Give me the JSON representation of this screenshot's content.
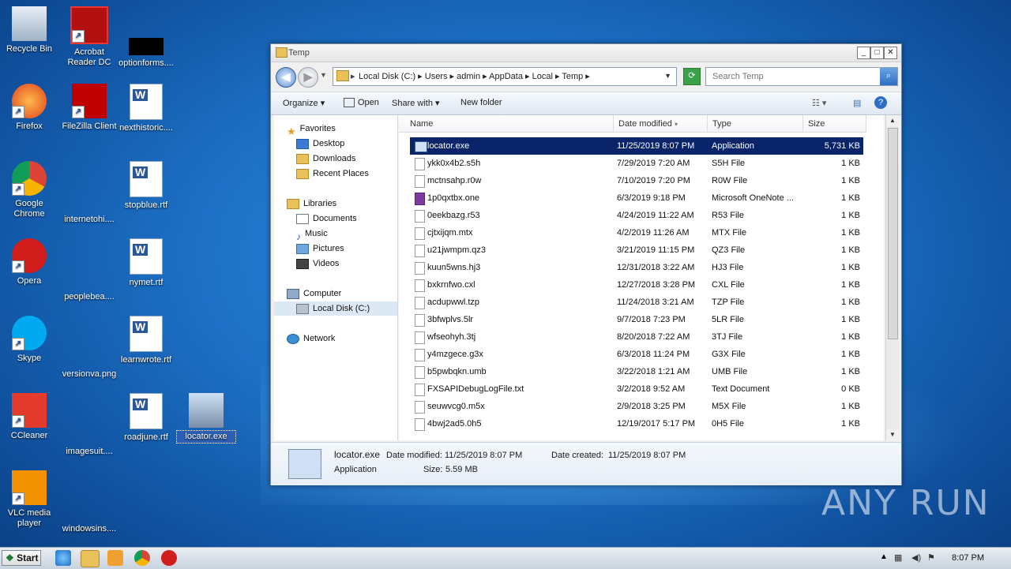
{
  "desktop": {
    "icons": [
      {
        "label": "Recycle Bin",
        "icon": "recycle-bin-icon"
      },
      {
        "label": "Acrobat Reader DC",
        "icon": "acrobat-icon"
      },
      {
        "label": "optionforms....",
        "icon": "file-icon"
      },
      {
        "label": "Firefox",
        "icon": "firefox-icon"
      },
      {
        "label": "FileZilla Client",
        "icon": "filezilla-icon"
      },
      {
        "label": "nexthistoric....",
        "icon": "word-document-icon"
      },
      {
        "label": "Google Chrome",
        "icon": "chrome-icon"
      },
      {
        "label": "internetohi....",
        "icon": "file-icon"
      },
      {
        "label": "stopblue.rtf",
        "icon": "word-document-icon"
      },
      {
        "label": "Opera",
        "icon": "opera-icon"
      },
      {
        "label": "peoplebea....",
        "icon": "file-icon"
      },
      {
        "label": "nymet.rtf",
        "icon": "word-document-icon"
      },
      {
        "label": "Skype",
        "icon": "skype-icon"
      },
      {
        "label": "versionva.png",
        "icon": "file-icon"
      },
      {
        "label": "learnwrote.rtf",
        "icon": "word-document-icon"
      },
      {
        "label": "CCleaner",
        "icon": "ccleaner-icon"
      },
      {
        "label": "imagesuit....",
        "icon": "file-icon"
      },
      {
        "label": "roadjune.rtf",
        "icon": "word-document-icon"
      },
      {
        "label": "locator.exe",
        "icon": "application-icon"
      },
      {
        "label": "VLC media player",
        "icon": "vlc-icon"
      },
      {
        "label": "windowsins....",
        "icon": "file-icon"
      }
    ]
  },
  "window": {
    "title": "Temp",
    "address": {
      "crumbs": [
        "Local Disk (C:)",
        "Users",
        "admin",
        "AppData",
        "Local",
        "Temp"
      ]
    },
    "search_placeholder": "Search Temp",
    "toolbar": {
      "organize": "Organize",
      "open": "Open",
      "share_with": "Share with",
      "new_folder": "New folder"
    },
    "nav": {
      "favorites": "Favorites",
      "desktop": "Desktop",
      "downloads": "Downloads",
      "recent_places": "Recent Places",
      "libraries": "Libraries",
      "documents": "Documents",
      "music": "Music",
      "pictures": "Pictures",
      "videos": "Videos",
      "computer": "Computer",
      "local_disk": "Local Disk (C:)",
      "network": "Network"
    },
    "columns": {
      "name": "Name",
      "date": "Date modified",
      "type": "Type",
      "size": "Size"
    },
    "files": [
      {
        "name": "locator.exe",
        "date": "11/25/2019 8:07 PM",
        "type": "Application",
        "size": "5,731 KB"
      },
      {
        "name": "ykk0x4b2.s5h",
        "date": "7/29/2019 7:20 AM",
        "type": "S5H File",
        "size": "1 KB"
      },
      {
        "name": "mctnsahp.r0w",
        "date": "7/10/2019 7:20 PM",
        "type": "R0W File",
        "size": "1 KB"
      },
      {
        "name": "1p0qxtbx.one",
        "date": "6/3/2019 9:18 PM",
        "type": "Microsoft OneNote ...",
        "size": "1 KB"
      },
      {
        "name": "0eekbazg.r53",
        "date": "4/24/2019 11:22 AM",
        "type": "R53 File",
        "size": "1 KB"
      },
      {
        "name": "cjtxijqm.mtx",
        "date": "4/2/2019 11:26 AM",
        "type": "MTX File",
        "size": "1 KB"
      },
      {
        "name": "u21jwmpm.qz3",
        "date": "3/21/2019 11:15 PM",
        "type": "QZ3 File",
        "size": "1 KB"
      },
      {
        "name": "kuun5wns.hj3",
        "date": "12/31/2018 3:22 AM",
        "type": "HJ3 File",
        "size": "1 KB"
      },
      {
        "name": "bxkrnfwo.cxl",
        "date": "12/27/2018 3:28 PM",
        "type": "CXL File",
        "size": "1 KB"
      },
      {
        "name": "acdupwwl.tzp",
        "date": "11/24/2018 3:21 AM",
        "type": "TZP File",
        "size": "1 KB"
      },
      {
        "name": "3bfwplvs.5lr",
        "date": "9/7/2018 7:23 PM",
        "type": "5LR File",
        "size": "1 KB"
      },
      {
        "name": "wfseohyh.3tj",
        "date": "8/20/2018 7:22 AM",
        "type": "3TJ File",
        "size": "1 KB"
      },
      {
        "name": "y4mzgece.g3x",
        "date": "6/3/2018 11:24 PM",
        "type": "G3X File",
        "size": "1 KB"
      },
      {
        "name": "b5pwbqkn.umb",
        "date": "3/22/2018 1:21 AM",
        "type": "UMB File",
        "size": "1 KB"
      },
      {
        "name": "FXSAPIDebugLogFile.txt",
        "date": "3/2/2018 9:52 AM",
        "type": "Text Document",
        "size": "0 KB"
      },
      {
        "name": "seuwvcg0.m5x",
        "date": "2/9/2018 3:25 PM",
        "type": "M5X File",
        "size": "1 KB"
      },
      {
        "name": "4bwj2ad5.0h5",
        "date": "12/19/2017 5:17 PM",
        "type": "0H5 File",
        "size": "1 KB"
      }
    ],
    "details": {
      "name": "locator.exe",
      "date_modified_label": "Date modified:",
      "date_modified": "11/25/2019 8:07 PM",
      "date_created_label": "Date created:",
      "date_created": "11/25/2019 8:07 PM",
      "type": "Application",
      "size_label": "Size:",
      "size": "5.59 MB"
    }
  },
  "taskbar": {
    "start": "Start",
    "clock": "8:07 PM"
  },
  "watermark": "ANY RUN"
}
